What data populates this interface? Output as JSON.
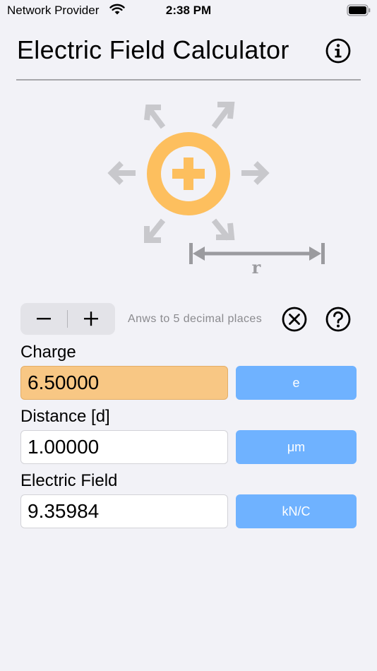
{
  "status_bar": {
    "carrier": "Network Provider",
    "time": "2:38 PM"
  },
  "header": {
    "title": "Electric Field Calculator",
    "info_icon": "info-circle-icon"
  },
  "illustration": {
    "charge_color": "#fdbf5e",
    "arrow_color": "#c8c8cc",
    "distance_bar_color": "#9b9b9f",
    "distance_label": "r"
  },
  "controls": {
    "decimals_note": "Anws to 5 decimal places",
    "minus_icon": "minus-icon",
    "plus_icon": "plus-icon",
    "clear_icon": "clear-circle-icon",
    "help_icon": "question-circle-icon"
  },
  "fields": [
    {
      "label": "Charge",
      "value": "6.50000",
      "unit": "e",
      "active": true
    },
    {
      "label": "Distance [d]",
      "value": "1.00000",
      "unit": "μm",
      "active": false
    },
    {
      "label": "Electric Field",
      "value": "9.35984",
      "unit": "kN/C",
      "active": false
    }
  ],
  "colors": {
    "background": "#f2f2f7",
    "active_field": "#f8c784",
    "unit_button": "#6fb2ff"
  }
}
